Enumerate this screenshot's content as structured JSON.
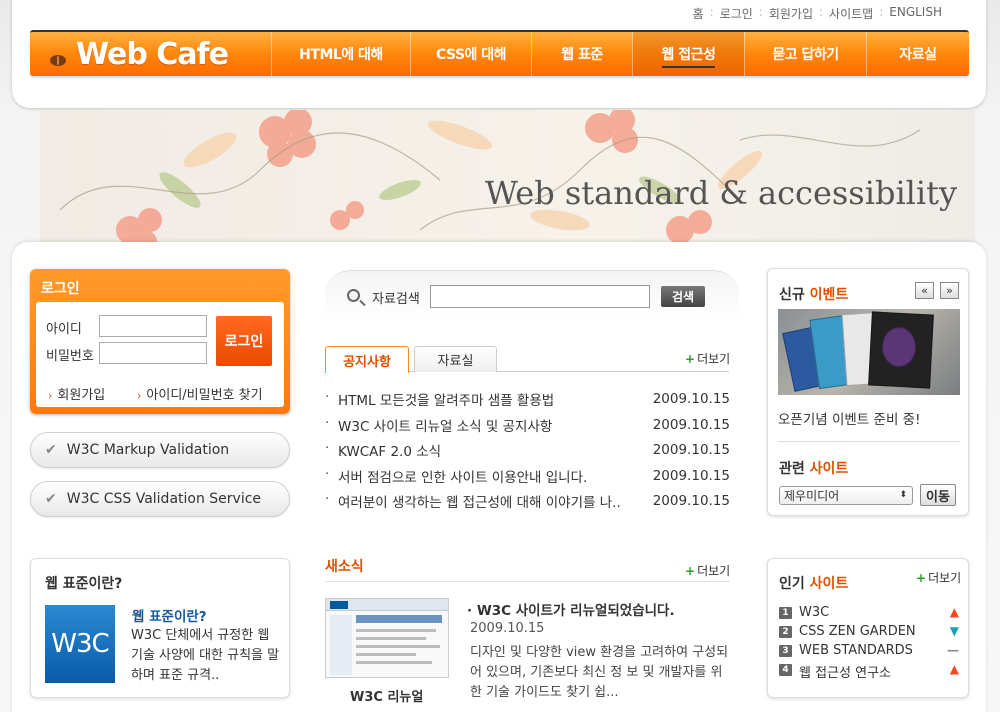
{
  "util_nav": [
    "홈",
    "로그인",
    "회원가입",
    "사이트맵",
    "ENGLISH"
  ],
  "logo": "Web Cafe",
  "menu": [
    "HTML에 대해",
    "CSS에 대해",
    "웹 표준",
    "웹 접근성",
    "묻고 답하기",
    "자료실"
  ],
  "menu_active_index": 3,
  "visual_title": "Web standard & accessibility",
  "login": {
    "title": "로그인",
    "id_label": "아이디",
    "pw_label": "비밀번호",
    "button": "로그인",
    "join": "회원가입",
    "find": "아이디/비밀번호 찾기"
  },
  "validation": [
    "W3C Markup Validation",
    "W3C CSS Validation Service"
  ],
  "search": {
    "label": "자료검색",
    "button": "검색"
  },
  "tabs": [
    "공지사항",
    "자료실"
  ],
  "more": "더보기",
  "notices": [
    {
      "title": "HTML 모든것을 알려주마 샘플 활용법",
      "date": "2009.10.15"
    },
    {
      "title": "W3C 사이트 리뉴얼 소식 및 공지사항",
      "date": "2009.10.15"
    },
    {
      "title": "KWCAF 2.0 소식",
      "date": "2009.10.15"
    },
    {
      "title": "서버 점검으로 인한 사이트 이용안내 입니다.",
      "date": "2009.10.15"
    },
    {
      "title": "여러분이 생각하는 웹 접근성에 대해 이야기를 나..",
      "date": "2009.10.15"
    }
  ],
  "news": {
    "title": "새소식",
    "thumb_caption": "W3C 리뉴얼",
    "headline": "W3C 사이트가 리뉴얼되었습니다.",
    "date": "2009.10.15",
    "body": "디자인 및 다양한 view 환경을 고려하여 구성되어 있으며, 기존보다 최신 정 보 및 개발자를 위한 기술 가이드도 찾기 쉽..."
  },
  "event": {
    "title_a": "신규",
    "title_b": "이벤트",
    "prev": "«",
    "next": "»",
    "text": "오픈기념 이벤트 준비 중!"
  },
  "related": {
    "title_a": "관련",
    "title_b": "사이트",
    "selected": "제우미디어",
    "button": "이동"
  },
  "popular": {
    "title_a": "인기",
    "title_b": "사이트",
    "items": [
      {
        "num": "1",
        "name": "W3C",
        "trend": "up"
      },
      {
        "num": "2",
        "name": "CSS ZEN GARDEN",
        "trend": "down"
      },
      {
        "num": "3",
        "name": "WEB STANDARDS",
        "trend": "same"
      },
      {
        "num": "4",
        "name": "웹 접근성 연구소",
        "trend": "up"
      }
    ]
  },
  "w3c_box": {
    "title": "웹 표준이란?",
    "logo": "W3C",
    "subtitle": "웹 표준이란?",
    "desc": "W3C 단체에서 규정한 웹 기술 사양에 대한 규칙을 말하며 표준 규격.."
  },
  "colors": {
    "accent": "#ff7a10",
    "highlight": "#e05000"
  }
}
